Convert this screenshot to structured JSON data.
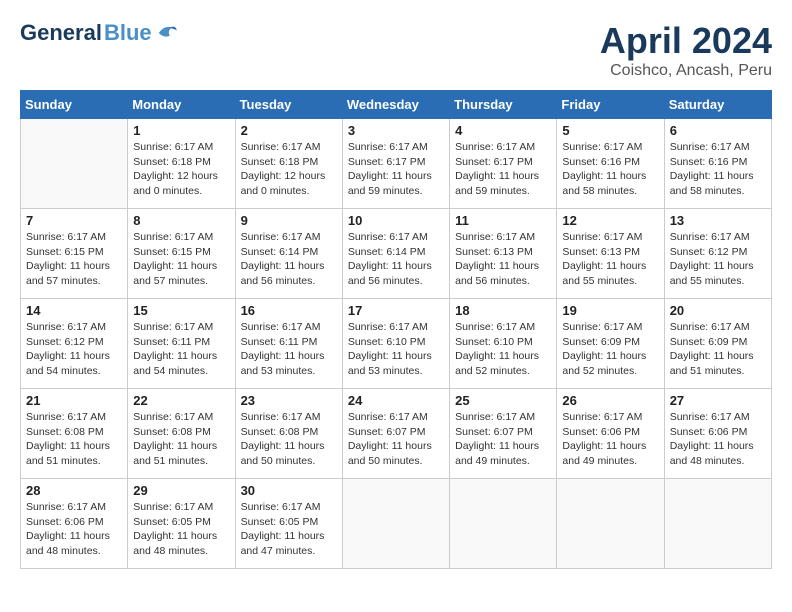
{
  "header": {
    "logo_general": "General",
    "logo_blue": "Blue",
    "title": "April 2024",
    "subtitle": "Coishco, Ancash, Peru"
  },
  "weekdays": [
    "Sunday",
    "Monday",
    "Tuesday",
    "Wednesday",
    "Thursday",
    "Friday",
    "Saturday"
  ],
  "weeks": [
    [
      {
        "day": "",
        "info": ""
      },
      {
        "day": "1",
        "info": "Sunrise: 6:17 AM\nSunset: 6:18 PM\nDaylight: 12 hours\nand 0 minutes."
      },
      {
        "day": "2",
        "info": "Sunrise: 6:17 AM\nSunset: 6:18 PM\nDaylight: 12 hours\nand 0 minutes."
      },
      {
        "day": "3",
        "info": "Sunrise: 6:17 AM\nSunset: 6:17 PM\nDaylight: 11 hours\nand 59 minutes."
      },
      {
        "day": "4",
        "info": "Sunrise: 6:17 AM\nSunset: 6:17 PM\nDaylight: 11 hours\nand 59 minutes."
      },
      {
        "day": "5",
        "info": "Sunrise: 6:17 AM\nSunset: 6:16 PM\nDaylight: 11 hours\nand 58 minutes."
      },
      {
        "day": "6",
        "info": "Sunrise: 6:17 AM\nSunset: 6:16 PM\nDaylight: 11 hours\nand 58 minutes."
      }
    ],
    [
      {
        "day": "7",
        "info": "Sunrise: 6:17 AM\nSunset: 6:15 PM\nDaylight: 11 hours\nand 57 minutes."
      },
      {
        "day": "8",
        "info": "Sunrise: 6:17 AM\nSunset: 6:15 PM\nDaylight: 11 hours\nand 57 minutes."
      },
      {
        "day": "9",
        "info": "Sunrise: 6:17 AM\nSunset: 6:14 PM\nDaylight: 11 hours\nand 56 minutes."
      },
      {
        "day": "10",
        "info": "Sunrise: 6:17 AM\nSunset: 6:14 PM\nDaylight: 11 hours\nand 56 minutes."
      },
      {
        "day": "11",
        "info": "Sunrise: 6:17 AM\nSunset: 6:13 PM\nDaylight: 11 hours\nand 56 minutes."
      },
      {
        "day": "12",
        "info": "Sunrise: 6:17 AM\nSunset: 6:13 PM\nDaylight: 11 hours\nand 55 minutes."
      },
      {
        "day": "13",
        "info": "Sunrise: 6:17 AM\nSunset: 6:12 PM\nDaylight: 11 hours\nand 55 minutes."
      }
    ],
    [
      {
        "day": "14",
        "info": "Sunrise: 6:17 AM\nSunset: 6:12 PM\nDaylight: 11 hours\nand 54 minutes."
      },
      {
        "day": "15",
        "info": "Sunrise: 6:17 AM\nSunset: 6:11 PM\nDaylight: 11 hours\nand 54 minutes."
      },
      {
        "day": "16",
        "info": "Sunrise: 6:17 AM\nSunset: 6:11 PM\nDaylight: 11 hours\nand 53 minutes."
      },
      {
        "day": "17",
        "info": "Sunrise: 6:17 AM\nSunset: 6:10 PM\nDaylight: 11 hours\nand 53 minutes."
      },
      {
        "day": "18",
        "info": "Sunrise: 6:17 AM\nSunset: 6:10 PM\nDaylight: 11 hours\nand 52 minutes."
      },
      {
        "day": "19",
        "info": "Sunrise: 6:17 AM\nSunset: 6:09 PM\nDaylight: 11 hours\nand 52 minutes."
      },
      {
        "day": "20",
        "info": "Sunrise: 6:17 AM\nSunset: 6:09 PM\nDaylight: 11 hours\nand 51 minutes."
      }
    ],
    [
      {
        "day": "21",
        "info": "Sunrise: 6:17 AM\nSunset: 6:08 PM\nDaylight: 11 hours\nand 51 minutes."
      },
      {
        "day": "22",
        "info": "Sunrise: 6:17 AM\nSunset: 6:08 PM\nDaylight: 11 hours\nand 51 minutes."
      },
      {
        "day": "23",
        "info": "Sunrise: 6:17 AM\nSunset: 6:08 PM\nDaylight: 11 hours\nand 50 minutes."
      },
      {
        "day": "24",
        "info": "Sunrise: 6:17 AM\nSunset: 6:07 PM\nDaylight: 11 hours\nand 50 minutes."
      },
      {
        "day": "25",
        "info": "Sunrise: 6:17 AM\nSunset: 6:07 PM\nDaylight: 11 hours\nand 49 minutes."
      },
      {
        "day": "26",
        "info": "Sunrise: 6:17 AM\nSunset: 6:06 PM\nDaylight: 11 hours\nand 49 minutes."
      },
      {
        "day": "27",
        "info": "Sunrise: 6:17 AM\nSunset: 6:06 PM\nDaylight: 11 hours\nand 48 minutes."
      }
    ],
    [
      {
        "day": "28",
        "info": "Sunrise: 6:17 AM\nSunset: 6:06 PM\nDaylight: 11 hours\nand 48 minutes."
      },
      {
        "day": "29",
        "info": "Sunrise: 6:17 AM\nSunset: 6:05 PM\nDaylight: 11 hours\nand 48 minutes."
      },
      {
        "day": "30",
        "info": "Sunrise: 6:17 AM\nSunset: 6:05 PM\nDaylight: 11 hours\nand 47 minutes."
      },
      {
        "day": "",
        "info": ""
      },
      {
        "day": "",
        "info": ""
      },
      {
        "day": "",
        "info": ""
      },
      {
        "day": "",
        "info": ""
      }
    ]
  ]
}
